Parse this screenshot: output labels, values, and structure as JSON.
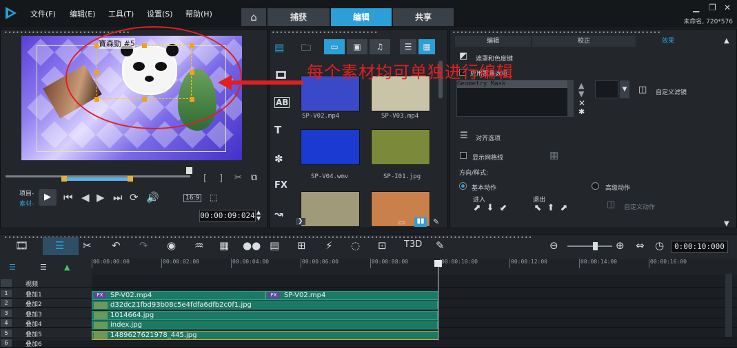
{
  "menu": [
    "文件(F)",
    "编辑(E)",
    "工具(T)",
    "设置(S)",
    "帮助(H)"
  ],
  "tabs": {
    "home_icon": "home-icon",
    "capture": "捕获",
    "edit": "编辑",
    "share": "共享",
    "active": "编辑"
  },
  "window": {
    "project_info": "未命名, 720*576"
  },
  "preview": {
    "overlay_title": "寶森勁  #5",
    "mode_project": "项目-",
    "mode_clip": "素材-",
    "aspect": "16:9",
    "timecode": "00:00:09:024"
  },
  "library": {
    "items": [
      {
        "label": "SP-V02.mp4",
        "color": "#3a49c8"
      },
      {
        "label": "SP-V03.mp4",
        "color": "#c9c3a8"
      },
      {
        "label": "SP-V04.wmv",
        "color": "#1a3ad0"
      },
      {
        "label": "SP-I01.jpg",
        "color": "#7a8a3a"
      },
      {
        "label": "",
        "color": "#a09a7a"
      },
      {
        "label": "",
        "color": "#c9804a"
      }
    ],
    "side_labels": [
      "AB",
      "T",
      "FX"
    ]
  },
  "options": {
    "tabs": [
      "编辑",
      "校正",
      "效果"
    ],
    "active_tab": "效果",
    "mask_chroma": "遮罩和色度键",
    "apply_fx": "应用覆叠选项",
    "fx_selected": "Geometry Mask",
    "custom_filter": "自定义滤镜",
    "align_options": "对齐选项",
    "show_grid": "显示网格线",
    "direction_style": "方向/样式:",
    "basic_motion": "基本动作",
    "advanced_motion": "高级动作",
    "enter": "进入",
    "exit": "退出",
    "custom_motion": "自定义动作"
  },
  "annotation": {
    "text": "每个素材均可单独进行编辑",
    "color": "#e02020"
  },
  "timeline": {
    "timecode": "0:00:10:000",
    "ruler": [
      "00:00:00:00",
      "00:00:02:00",
      "00:00:04:00",
      "00:00:06:00",
      "00:00:08:00",
      "00:00:10:00",
      "00:00:12:00",
      "00:00:14:00",
      "00:00:16:00"
    ],
    "tracks": [
      {
        "num": "",
        "name": "视频"
      },
      {
        "num": "1",
        "name": "叠加1"
      },
      {
        "num": "2",
        "name": "叠加2"
      },
      {
        "num": "3",
        "name": "叠加3"
      },
      {
        "num": "4",
        "name": "叠加4"
      },
      {
        "num": "5",
        "name": "叠加5"
      },
      {
        "num": "6",
        "name": "叠加6"
      }
    ],
    "clips": [
      {
        "track": 1,
        "label": "SP-V02.mp4",
        "fx": true
      },
      {
        "track": 1,
        "label": "SP-V02.mp4",
        "fx": true
      },
      {
        "track": 2,
        "label": "d32dc21fbd93b08c5e4fdfa6dfb2c0f1.jpg",
        "fx": false
      },
      {
        "track": 3,
        "label": "1014664.jpg",
        "fx": false
      },
      {
        "track": 4,
        "label": "index.jpg",
        "fx": false
      },
      {
        "track": 5,
        "label": "1489627621978_445.jpg",
        "fx": false
      }
    ]
  },
  "colors": {
    "accent": "#2b9fd6",
    "clip": "#1b7a66",
    "trim": "#e4b23a"
  }
}
